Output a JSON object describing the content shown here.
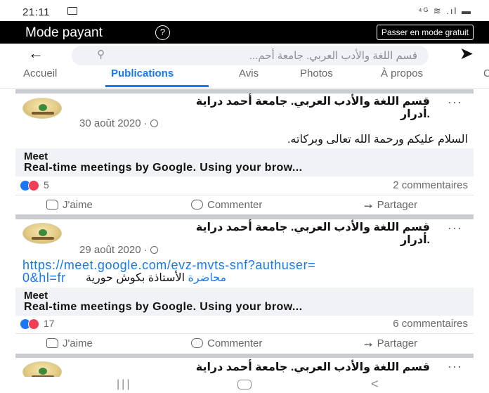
{
  "status_bar": {
    "time": "21:11",
    "signal_text": "⁴ᴳ ≋ .ıl ▬"
  },
  "pay_bar": {
    "title": "Mode payant",
    "help_symbol": "?",
    "switch_button": "Passer en mode gratuit"
  },
  "search": {
    "placeholder": "قسم اللغة والأدب العربي. جامعة أحم..."
  },
  "tabs": [
    "Accueil",
    "Publications",
    "Avis",
    "Photos",
    "À propos",
    "C"
  ],
  "posts": [
    {
      "author_line1": "قسم اللغة والأدب العربي. جامعة أحمد دراية",
      "author_line2": ".أدرار",
      "date": "30 août 2020 ·",
      "text": "السلام عليكم ورحمة الله تعالى وبركاته.",
      "preview_title": "Meet",
      "preview_desc": "Real-time meetings by Google. Using your brow...",
      "reaction_count": "5",
      "comments": "2 commentaires"
    },
    {
      "author_line1": "قسم اللغة والأدب العربي. جامعة أحمد دراية",
      "author_line2": ".أدرار",
      "date": "29 août 2020 ·",
      "link_line1": "https://meet.google.com/evz-mvts-snf?authuser=",
      "link_line2": "0&hl=fr",
      "link_word": "محاضرة",
      "text_after_link": "الأستاذة بكوش حورية",
      "preview_title": "Meet",
      "preview_desc": "Real-time meetings by Google. Using your brow...",
      "reaction_count": "17",
      "comments": "6 commentaires"
    },
    {
      "author_line1": "قسم اللغة والأدب العربي. جامعة أحمد دراية"
    }
  ],
  "actions": {
    "like": "J'aime",
    "comment": "Commenter",
    "share": "Partager"
  },
  "colors": {
    "accent": "#1877f2",
    "paybar": "#000000",
    "love": "#f33e58"
  }
}
